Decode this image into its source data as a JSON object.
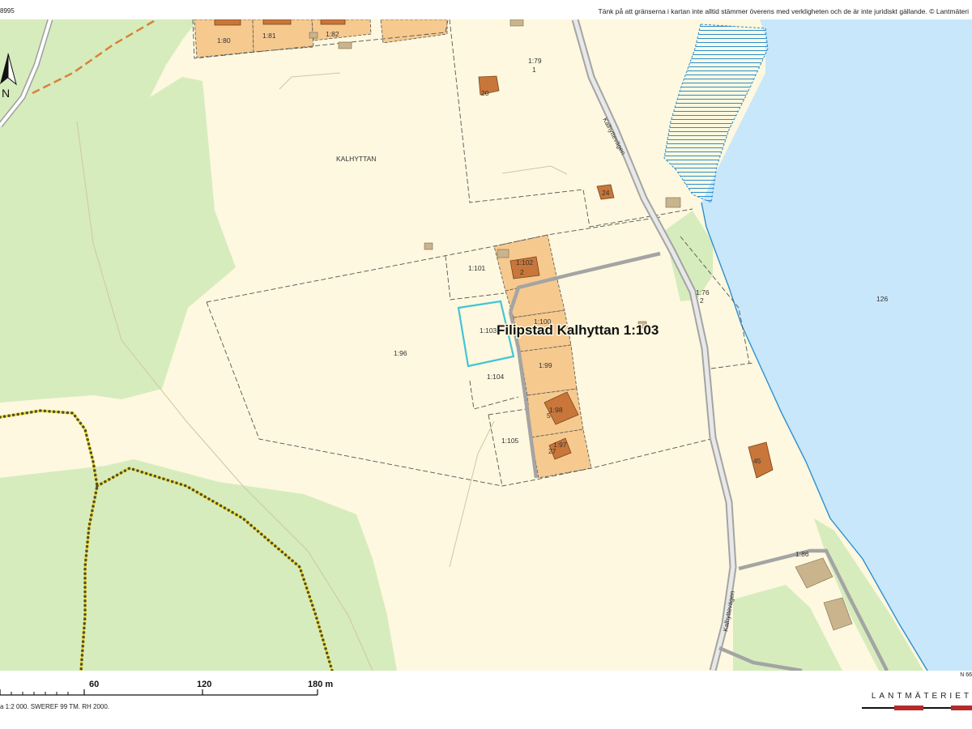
{
  "header": {
    "doc_id_fragment": "8995",
    "disclaimer": "Tänk på att gränserna i kartan inte alltid stämmer överens med verkligheten och de är inte juridiskt gällande. © Lantmäteri"
  },
  "map": {
    "north_label": "N",
    "title": "Filipstad Kalhyttan 1:103",
    "area_name": "KALHYTTAN",
    "parcels": [
      "1:80",
      "1:81",
      "1:82",
      "1:79",
      "1:101",
      "1:102",
      "1:103",
      "1:104",
      "1:105",
      "1:96",
      "1:99",
      "1:98",
      "1:97",
      "1:76",
      "1:86",
      "1:100"
    ],
    "parcel_numbers": [
      "1",
      "2",
      "2"
    ],
    "house_numbers": [
      "20",
      "24",
      "2",
      "45",
      "5",
      "27"
    ],
    "streets": [
      "Kalhyttevägen",
      "Kalhyttevägen"
    ],
    "lake_label": "126",
    "coord_fragment": "N 66",
    "colors": {
      "background": "#fdf8df",
      "forest": "#d6ecbd",
      "water": "#c8e7fb",
      "shoreline": "#2e8fd0",
      "tomt": "#f6c98f",
      "building": "#c8763a",
      "outbuilding": "#c9b48e",
      "road": "#a4a4a4",
      "highlight": "#44c4d6",
      "trail": "#f0df3c",
      "power_line": "#d9813a"
    }
  },
  "scale": {
    "labels": [
      "60",
      "120",
      "180 m"
    ],
    "info": "a 1:2 000. SWEREF 99 TM. RH 2000."
  },
  "brand": "LANTMÄTERIET"
}
